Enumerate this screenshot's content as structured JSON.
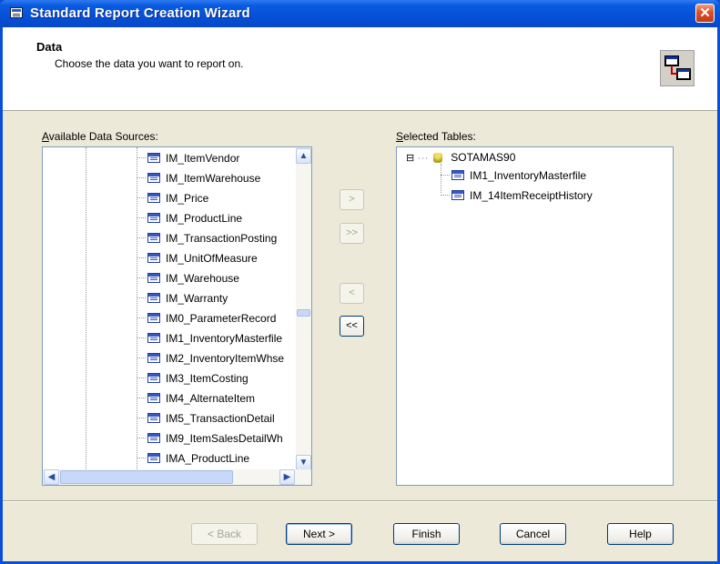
{
  "window": {
    "title": "Standard Report Creation Wizard",
    "close_glyph": "✕"
  },
  "header": {
    "title": "Data",
    "subtitle": "Choose the data you want to report on."
  },
  "available": {
    "label": "Available Data Sources:",
    "items": [
      "IM_ItemVendor",
      "IM_ItemWarehouse",
      "IM_Price",
      "IM_ProductLine",
      "IM_TransactionPosting",
      "IM_UnitOfMeasure",
      "IM_Warehouse",
      "IM_Warranty",
      "IM0_ParameterRecord",
      "IM1_InventoryMasterfile",
      "IM2_InventoryItemWhse",
      "IM3_ItemCosting",
      "IM4_AlternateItem",
      "IM5_TransactionDetail",
      "IM9_ItemSalesDetailWh",
      "IMA_ProductLine"
    ]
  },
  "selected": {
    "label": "Selected Tables:",
    "root": "SOTAMAS90",
    "expander": "⊟",
    "items": [
      "IM1_InventoryMasterfile",
      "IM_14ItemReceiptHistory"
    ]
  },
  "move_buttons": {
    "add": ">",
    "add_all": ">>",
    "remove": "<",
    "remove_all": "<<"
  },
  "scroll_glyphs": {
    "up": "▲",
    "down": "▼",
    "left": "◀",
    "right": "▶"
  },
  "buttons": {
    "back": "< Back",
    "next": "Next >",
    "finish": "Finish",
    "cancel": "Cancel",
    "help": "Help"
  }
}
